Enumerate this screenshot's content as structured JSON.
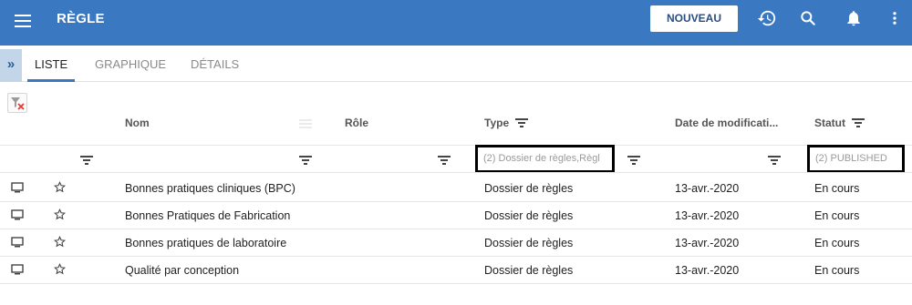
{
  "topbar": {
    "title": "RÈGLE",
    "new_button": "NOUVEAU",
    "icons": [
      "menu-icon",
      "history-icon",
      "search-icon",
      "bell-icon",
      "more-vert-icon"
    ],
    "color": "#3a78c2"
  },
  "tabs": [
    {
      "label": "LISTE",
      "active": true
    },
    {
      "label": "GRAPHIQUE",
      "active": false
    },
    {
      "label": "DÉTAILS",
      "active": false
    }
  ],
  "table": {
    "columns": [
      "Nom",
      "Rôle",
      "Type",
      "Date de modificati...",
      "Statut"
    ],
    "filters": {
      "type": "(2) Dossier de règles,Règl",
      "statut": "(2) PUBLISHED"
    },
    "rows": [
      {
        "nom": "Bonnes pratiques cliniques (BPC)",
        "type": "Dossier de règles",
        "date": "13-avr.-2020",
        "statut": "En cours"
      },
      {
        "nom": "Bonnes Pratiques de Fabrication",
        "type": "Dossier de règles",
        "date": "13-avr.-2020",
        "statut": "En cours"
      },
      {
        "nom": "Bonnes pratiques de laboratoire",
        "type": "Dossier de règles",
        "date": "13-avr.-2020",
        "statut": "En cours"
      },
      {
        "nom": "Qualité par conception",
        "type": "Dossier de règles",
        "date": "13-avr.-2020",
        "statut": "En cours"
      }
    ]
  }
}
